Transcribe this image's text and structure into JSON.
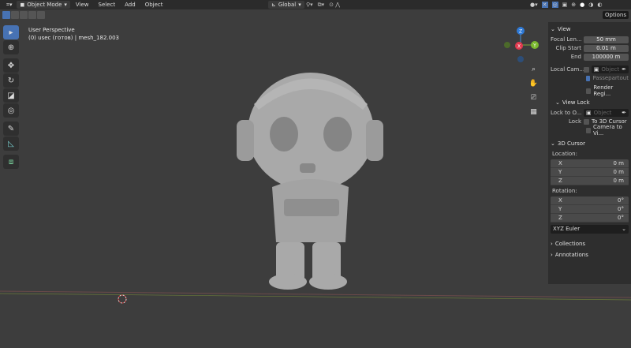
{
  "header": {
    "mode": "Object Mode",
    "menus": [
      "View",
      "Select",
      "Add",
      "Object"
    ],
    "orientation": "Global",
    "tooltip": "Options"
  },
  "viewport": {
    "title": "User Perspective",
    "subtitle": "(0) usec (готов) | mesh_182.003"
  },
  "gizmo": {
    "z": "Z",
    "y": "Y",
    "x": "X"
  },
  "toolbar": {
    "tools": [
      "select-box",
      "cursor",
      "move",
      "rotate",
      "scale",
      "transform",
      "annotate",
      "measure",
      "add-cube"
    ]
  },
  "panel": {
    "view": {
      "title": "View",
      "focal_label": "Focal Len...",
      "focal": "50 mm",
      "clip_start_label": "Clip Start",
      "clip_start": "0.01 m",
      "end_label": "End",
      "end": "100000 m",
      "local_cam_label": "Local Cam...",
      "local_cam_placeholder": "Object",
      "passepartout": "Passepartout",
      "render_region": "Render Regi..."
    },
    "view_lock": {
      "title": "View Lock",
      "lock_to_label": "Lock to O...",
      "lock_to_placeholder": "Object",
      "lock_label": "Lock",
      "to_cursor": "To 3D Cursor",
      "camera_to_view": "Camera to Vi..."
    },
    "cursor": {
      "title": "3D Cursor",
      "location_label": "Location:",
      "location": [
        {
          "axis": "X",
          "value": "0 m"
        },
        {
          "axis": "Y",
          "value": "0 m"
        },
        {
          "axis": "Z",
          "value": "0 m"
        }
      ],
      "rotation_label": "Rotation:",
      "rotation": [
        {
          "axis": "X",
          "value": "0°"
        },
        {
          "axis": "Y",
          "value": "0°"
        },
        {
          "axis": "Z",
          "value": "0°"
        }
      ],
      "mode": "XYZ Euler"
    },
    "collections": "Collections",
    "annotations": "Annotations"
  }
}
